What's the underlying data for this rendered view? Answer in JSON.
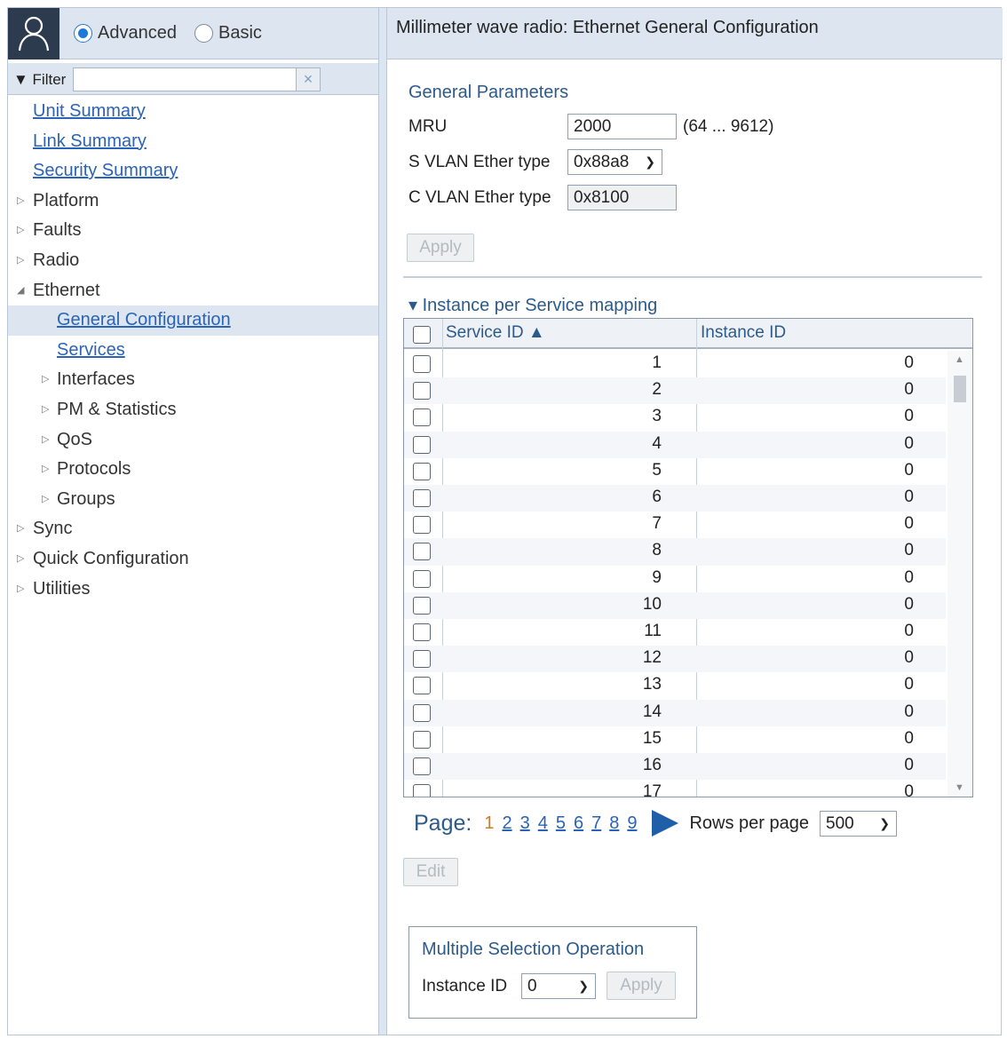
{
  "mode": {
    "advanced_label": "Advanced",
    "basic_label": "Basic",
    "selected": "Advanced"
  },
  "filter": {
    "label": "▼ Filter",
    "value": "",
    "clear_label": "×"
  },
  "nav": {
    "unit_summary": "Unit Summary",
    "link_summary": "Link Summary",
    "security_summary": "Security Summary",
    "platform": "Platform",
    "faults": "Faults",
    "radio": "Radio",
    "ethernet": "Ethernet",
    "general_configuration": "General Configuration",
    "services": "Services",
    "interfaces": "Interfaces",
    "pm_statistics": "PM & Statistics",
    "qos": "QoS",
    "protocols": "Protocols",
    "groups": "Groups",
    "sync": "Sync",
    "quick_configuration": "Quick Configuration",
    "utilities": "Utilities"
  },
  "header": {
    "title": "Millimeter wave radio: Ethernet General Configuration"
  },
  "general": {
    "title": "General Parameters",
    "mru_label": "MRU",
    "mru_value": "2000",
    "mru_range": "(64 ... 9612)",
    "svlan_label": "S VLAN Ether type",
    "svlan_value": "0x88a8",
    "cvlan_label": "C VLAN Ether type",
    "cvlan_value": "0x8100",
    "apply_label": "Apply"
  },
  "mapping": {
    "title": "▾ Instance per Service mapping",
    "col_service": "Service ID ▲",
    "col_instance": "Instance ID",
    "rows": [
      {
        "service_id": "1",
        "instance_id": "0"
      },
      {
        "service_id": "2",
        "instance_id": "0"
      },
      {
        "service_id": "3",
        "instance_id": "0"
      },
      {
        "service_id": "4",
        "instance_id": "0"
      },
      {
        "service_id": "5",
        "instance_id": "0"
      },
      {
        "service_id": "6",
        "instance_id": "0"
      },
      {
        "service_id": "7",
        "instance_id": "0"
      },
      {
        "service_id": "8",
        "instance_id": "0"
      },
      {
        "service_id": "9",
        "instance_id": "0"
      },
      {
        "service_id": "10",
        "instance_id": "0"
      },
      {
        "service_id": "11",
        "instance_id": "0"
      },
      {
        "service_id": "12",
        "instance_id": "0"
      },
      {
        "service_id": "13",
        "instance_id": "0"
      },
      {
        "service_id": "14",
        "instance_id": "0"
      },
      {
        "service_id": "15",
        "instance_id": "0"
      },
      {
        "service_id": "16",
        "instance_id": "0"
      },
      {
        "service_id": "17",
        "instance_id": "0"
      }
    ]
  },
  "pagination": {
    "label": "Page:",
    "current": "1",
    "pages": [
      "2",
      "3",
      "4",
      "5",
      "6",
      "7",
      "8",
      "9"
    ],
    "rows_per_page_label": "Rows per page",
    "rows_per_page_value": "500"
  },
  "edit_label": "Edit",
  "multi": {
    "title": "Multiple Selection Operation",
    "instance_label": "Instance ID",
    "instance_value": "0",
    "apply_label": "Apply"
  }
}
